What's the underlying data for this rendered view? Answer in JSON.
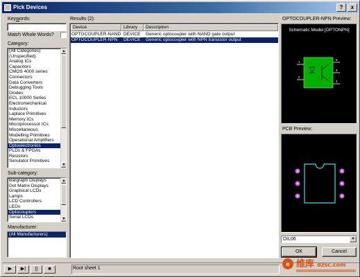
{
  "window": {
    "title": "Pick Devices",
    "help_label": "?",
    "close_label": "x"
  },
  "keywords": {
    "label_prefix": "Key",
    "label_underline": "w",
    "label_suffix": "ords:",
    "value": ""
  },
  "match_whole_words": {
    "label": "Match Whole Words?",
    "checked": false
  },
  "category": {
    "label": "Category:",
    "selected_index": 26,
    "items": [
      "(All Categories)",
      "(Unspecified)",
      "Analog ICs",
      "Capacitors",
      "CMOS 4000 series",
      "Connectors",
      "Data Converters",
      "Debugging Tools",
      "Diodes",
      "ECL 10000 Series",
      "Electromechanical",
      "Inductors",
      "Laplace Primitives",
      "Memory ICs",
      "Microprocessor ICs",
      "Miscellaneous",
      "Modelling Primitives",
      "Operational Amplifiers",
      "Optoelectronics",
      "PLDs & FPGAs",
      "Resistors",
      "Simulator Primitives"
    ]
  },
  "subcategory": {
    "label": "Sub-category:",
    "items": [
      "Bargraph Displays",
      "Dot Matrix Displays",
      "Graphical LCDs",
      "Lamps",
      "LCD Controllers",
      "LEDs",
      "Optocouplers",
      "Serial LCDs"
    ],
    "selected": "Optocouplers"
  },
  "manufacturer": {
    "label": "Manufacturer:",
    "items": [
      "(All Manufacturers)"
    ],
    "selected": "(All Manufacturers)"
  },
  "results": {
    "label": "Results (2):",
    "columns": [
      "Device",
      "Library",
      "Description"
    ],
    "rows": [
      {
        "device": "OPTOCOUPLER-NAND",
        "library": "DEVICE",
        "description": "Generic optocoupler with NAND gate output",
        "selected": false
      },
      {
        "device": "OPTOCOUPLER-NPN",
        "library": "DEVICE",
        "description": "Generic optocoupler with NPN transistor output",
        "selected": true
      }
    ]
  },
  "preview": {
    "title": "OPTOCOUPLER-NPN Preview:",
    "schematic_label": "Schematic Model [OPTONPN]",
    "schematic_pins": [
      "1",
      "2",
      "3",
      "4",
      "6"
    ],
    "pcb_label": "PCB Preview:",
    "package_value": "DIL06",
    "colors": {
      "background": "#000000",
      "component_body": "#00b000",
      "pad": "#d060e0",
      "outline": "#40e0e0",
      "pin_line": "#ffffff"
    }
  },
  "buttons": {
    "ok": "OK",
    "cancel": "Cancel"
  },
  "statusbar": {
    "play_icons": [
      "play-icon",
      "step-icon",
      "pause-icon",
      "stop-icon"
    ],
    "text": "Root sheet 1"
  },
  "watermark": {
    "text": "维库",
    "subtext": "dzsc.com"
  }
}
